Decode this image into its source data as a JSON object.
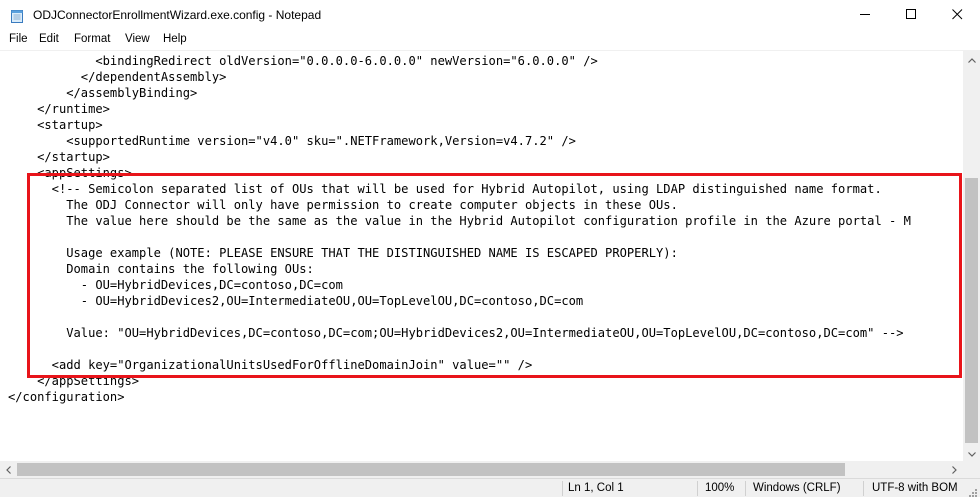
{
  "window": {
    "title": "ODJConnectorEnrollmentWizard.exe.config - Notepad",
    "icon": "notepad-icon",
    "controls": [
      "minimize-icon",
      "maximize-icon",
      "close-icon"
    ]
  },
  "menu": {
    "items": [
      "File",
      "Edit",
      "Format",
      "View",
      "Help"
    ]
  },
  "editor": {
    "lines": [
      "            <bindingRedirect oldVersion=\"0.0.0.0-6.0.0.0\" newVersion=\"6.0.0.0\" />",
      "          </dependentAssembly>",
      "        </assemblyBinding>",
      "    </runtime>",
      "    <startup>",
      "        <supportedRuntime version=\"v4.0\" sku=\".NETFramework,Version=v4.7.2\" />",
      "    </startup>",
      "    <appSettings>",
      "      <!-- Semicolon separated list of OUs that will be used for Hybrid Autopilot, using LDAP distinguished name format.",
      "        The ODJ Connector will only have permission to create computer objects in these OUs.",
      "        The value here should be the same as the value in the Hybrid Autopilot configuration profile in the Azure portal - M",
      "",
      "        Usage example (NOTE: PLEASE ENSURE THAT THE DISTINGUISHED NAME IS ESCAPED PROPERLY):",
      "        Domain contains the following OUs:",
      "          - OU=HybridDevices,DC=contoso,DC=com",
      "          - OU=HybridDevices2,OU=IntermediateOU,OU=TopLevelOU,DC=contoso,DC=com",
      "",
      "        Value: \"OU=HybridDevices,DC=contoso,DC=com;OU=HybridDevices2,OU=IntermediateOU,OU=TopLevelOU,DC=contoso,DC=com\" -->",
      "",
      "      <add key=\"OrganizationalUnitsUsedForOfflineDomainJoin\" value=\"\" />",
      "    </appSettings>",
      "</configuration>"
    ],
    "highlight_color": "#e8141a"
  },
  "status": {
    "position": "Ln 1, Col 1",
    "zoom": "100%",
    "line_ending": "Windows (CRLF)",
    "encoding": "UTF-8 with BOM"
  }
}
